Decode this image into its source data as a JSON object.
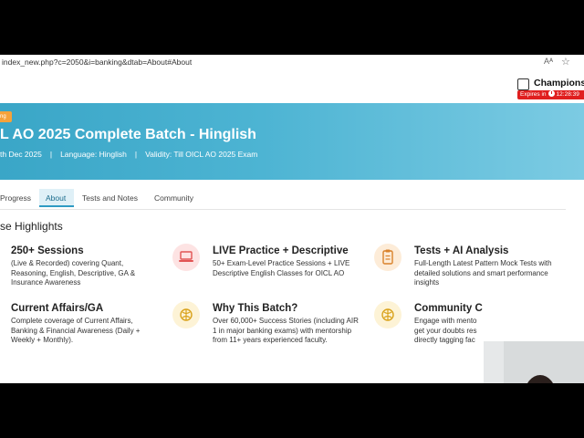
{
  "browser": {
    "url": "index_new.php?c=2050&i=banking&dtab=About#About",
    "reader_icon_label": "Aᴬ"
  },
  "site": {
    "logo_text": "Champions S",
    "expiry_label": "Expires in",
    "expiry_time": "12:28:39"
  },
  "banner": {
    "badge": "ng",
    "title": "L AO 2025 Complete Batch - Hinglish",
    "date": "th Dec 2025",
    "language": "Language: Hinglish",
    "validity": "Validity:  Till OICL AO 2025 Exam",
    "separator": "|"
  },
  "tabs": [
    {
      "label": "Progress"
    },
    {
      "label": "About",
      "active": true
    },
    {
      "label": "Tests and Notes"
    },
    {
      "label": "Community"
    }
  ],
  "highlights": {
    "title": "se Highlights",
    "items": [
      {
        "title": "250+ Sessions",
        "desc": "(Live & Recorded) covering Quant, Reasoning, English, Descriptive, GA & Insurance Awareness"
      },
      {
        "title": "LIVE Practice + Descriptive",
        "desc": "50+ Exam-Level Practice Sessions + LIVE Descriptive English Classes for OICL AO",
        "icon": "laptop-icon"
      },
      {
        "title": "Tests + AI Analysis",
        "desc": "Full-Length Latest Pattern Mock Tests with detailed solutions and smart performance insights",
        "icon": "clipboard-icon"
      },
      {
        "title": "Current Affairs/GA",
        "desc": "Complete coverage of Current Affairs, Banking & Financial Awareness (Daily + Weekly + Monthly)."
      },
      {
        "title": "Why This Batch?",
        "desc": "Over 60,000+ Success Stories (including AIR 1 in major banking exams) with mentorship from 11+ years experienced faculty.",
        "icon": "brain-icon"
      },
      {
        "title": "Community C",
        "desc": "Engage with mento get your doubts res directly tagging fac",
        "icon": "brain-icon"
      }
    ]
  },
  "colors": {
    "banner_start": "#3aa6c7",
    "banner_end": "#7ccbe3",
    "badge": "#f5a23b",
    "tab_active_bg": "#dff0f7",
    "expiry_red": "#e01f1f",
    "icon_red_bg": "#fde3e3",
    "icon_orange_bg": "#fdecd8",
    "icon_yellow_bg": "#fdf3d6"
  }
}
